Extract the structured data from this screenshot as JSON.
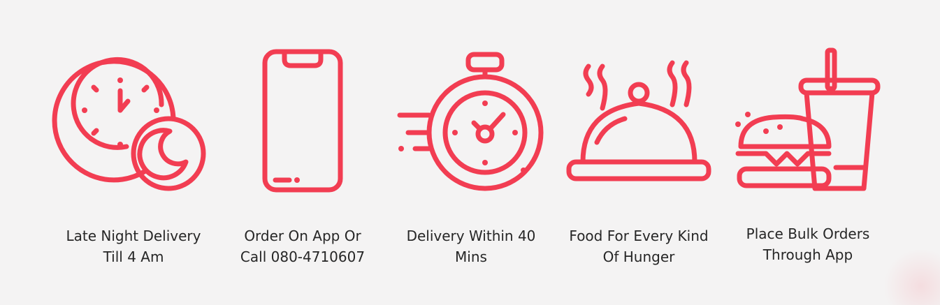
{
  "colors": {
    "background": "#f4f3f3",
    "accent": "#f23d52",
    "text": "#262626"
  },
  "features": [
    {
      "icon": "clock-moon-icon",
      "label_line1": "Late Night Delivery",
      "label_line2": "Till 4 Am"
    },
    {
      "icon": "smartphone-icon",
      "label_line1": "Order On App Or",
      "label_line2": "Call 080-4710607"
    },
    {
      "icon": "stopwatch-icon",
      "label_line1": "Delivery Within 40",
      "label_line2": "Mins"
    },
    {
      "icon": "food-cloche-icon",
      "label_line1": "Food For Every Kind",
      "label_line2": "Of Hunger"
    },
    {
      "icon": "burger-drink-icon",
      "label_line1": "Place Bulk Orders",
      "label_line2": "Through App"
    }
  ]
}
